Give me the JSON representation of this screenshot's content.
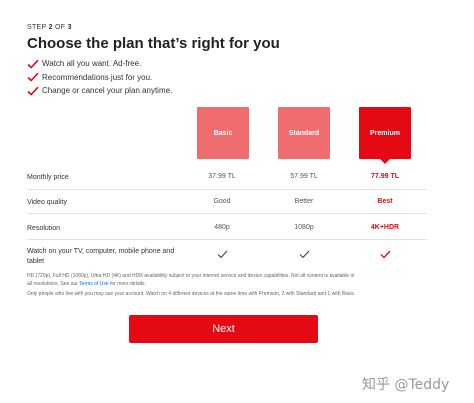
{
  "header": {
    "step_prefix": "STEP ",
    "step_current": "2",
    "step_mid": " OF ",
    "step_total": "3",
    "title": "Choose the plan that’s right for you"
  },
  "features": [
    "Watch all you want. Ad-free.",
    "Recommendations just for you.",
    "Change or cancel your plan anytime."
  ],
  "plans": [
    {
      "name": "Basic",
      "price": "37.99 TL",
      "video_quality": "Good",
      "resolution": "480p",
      "all_devices": true
    },
    {
      "name": "Standard",
      "price": "57.99 TL",
      "video_quality": "Better",
      "resolution": "1080p",
      "all_devices": true
    },
    {
      "name": "Premium",
      "price": "77.99 TL",
      "video_quality": "Best",
      "resolution": "4K+HDR",
      "all_devices": true,
      "selected": true
    }
  ],
  "rows": {
    "price_label": "Monthly price",
    "video_label": "Video quality",
    "resolution_label": "Resolution",
    "devices_label": "Watch on your TV, computer, mobile phone and tablet"
  },
  "fine_print": {
    "line1_pre": "HD (720p), Full HD (1080p), Ultra HD (4K) and HDR availability subject to your internet service and device capabilities. Not all content is available in all resolutions. See our ",
    "terms_link": "Terms of Use",
    "line1_post": " for more details.",
    "line2": "Only people who live with you may use your account. Watch on 4 different devices at the same time with Premium, 2 with Standard and 1 with Basic."
  },
  "next_label": "Next",
  "watermark": "知乎 @Teddy",
  "colors": {
    "brand_red": "#e50914",
    "unselected_plan": "#ef6c6f",
    "link_blue": "#0071eb"
  },
  "icons": {
    "feature_check": "check-icon",
    "device_tick": "checkmark-icon",
    "selected_arrow": "caret-down-icon"
  }
}
